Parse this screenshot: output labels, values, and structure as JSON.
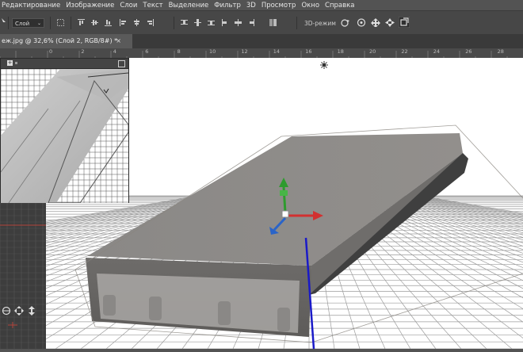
{
  "menu": [
    "Редактирование",
    "Изображение",
    "Слои",
    "Текст",
    "Выделение",
    "Фильтр",
    "3D",
    "Просмотр",
    "Окно",
    "Справка"
  ],
  "options": {
    "layer_select": "Слой",
    "mode_label": "3D-режим"
  },
  "document_tab": {
    "title": "еж.jpg @ 32,6% (Слой 2, RGB/8#) *",
    "close": "×"
  },
  "ruler_numbers": [
    "0",
    "2",
    "4",
    "6",
    "8",
    "10",
    "12",
    "14",
    "16",
    "18",
    "20",
    "22",
    "24",
    "26",
    "28"
  ],
  "colors": {
    "axis_y": "#2e9b2e",
    "axis_x": "#d23030",
    "axis_z": "#2a64c8",
    "ground_line": "#1a1ac8"
  }
}
